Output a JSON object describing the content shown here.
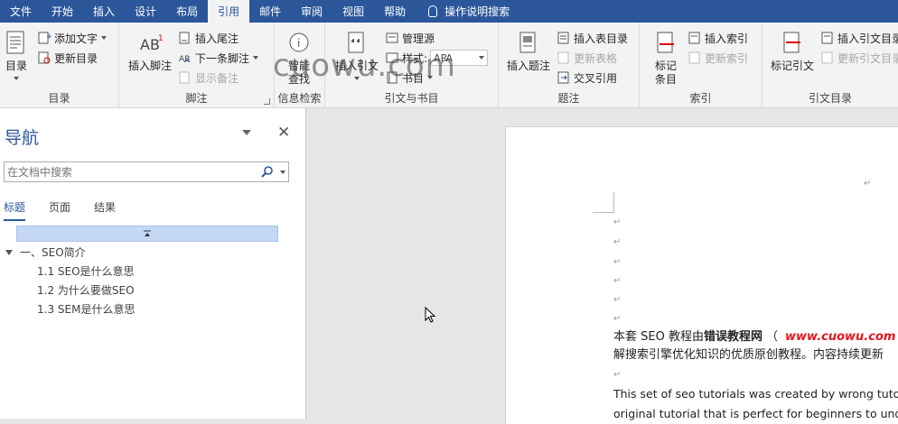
{
  "tabs": [
    "文件",
    "开始",
    "插入",
    "设计",
    "布局",
    "引用",
    "邮件",
    "审阅",
    "视图",
    "帮助",
    "操作说明搜索"
  ],
  "active_tab": "引用",
  "watermark": "cuowu.com",
  "ribbon": {
    "toc": {
      "big": "目录",
      "add_text": "添加文字",
      "update": "更新目录",
      "label": "目录"
    },
    "footnotes": {
      "big": "插入脚注",
      "endnote": "插入尾注",
      "next": "下一条脚注",
      "show": "显示备注",
      "label": "脚注"
    },
    "research": {
      "big_line1": "智能",
      "big_line2": "查找",
      "label": "信息检索"
    },
    "citations": {
      "big": "插入引文",
      "manage": "管理源",
      "style_label": "样式:",
      "style_value": "APA",
      "biblio": "书目",
      "label": "引文与书目"
    },
    "captions": {
      "big": "插入题注",
      "table_of_figures": "插入表目录",
      "update_table": "更新表格",
      "cross_ref": "交叉引用",
      "label": "题注"
    },
    "index": {
      "big_line1": "标记",
      "big_line2": "条目",
      "insert": "插入索引",
      "update": "更新索引",
      "label": "索引"
    },
    "toa": {
      "big": "标记引文",
      "insert": "插入引文目录",
      "update": "更新引文目录",
      "label": "引文目录"
    }
  },
  "nav": {
    "title": "导航",
    "search_placeholder": "在文档中搜索",
    "tabs": [
      "标题",
      "页面",
      "结果"
    ],
    "headings": [
      "一、SEO简介",
      "1.1 SEO是什么意思",
      "1.2 为什么要做SEO",
      "1.3 SEM是什么意思"
    ]
  },
  "doc": {
    "para1_a": "本套 SEO 教程由",
    "para1_b": "错误教程网",
    "para1_c": "（",
    "para1_link": "www.cuowu.com",
    "para1_d": "）",
    "para1_line2": "解搜索引擎优化知识的优质原创教程。内容持续更新",
    "para2_line1": "This set of seo tutorials was created by wrong tutoria",
    "para2_line2": "original tutorial that is perfect for beginners to under",
    "para_mark": "↵"
  },
  "colors": {
    "accent": "#2b579a",
    "link_red": "#e8131b"
  }
}
